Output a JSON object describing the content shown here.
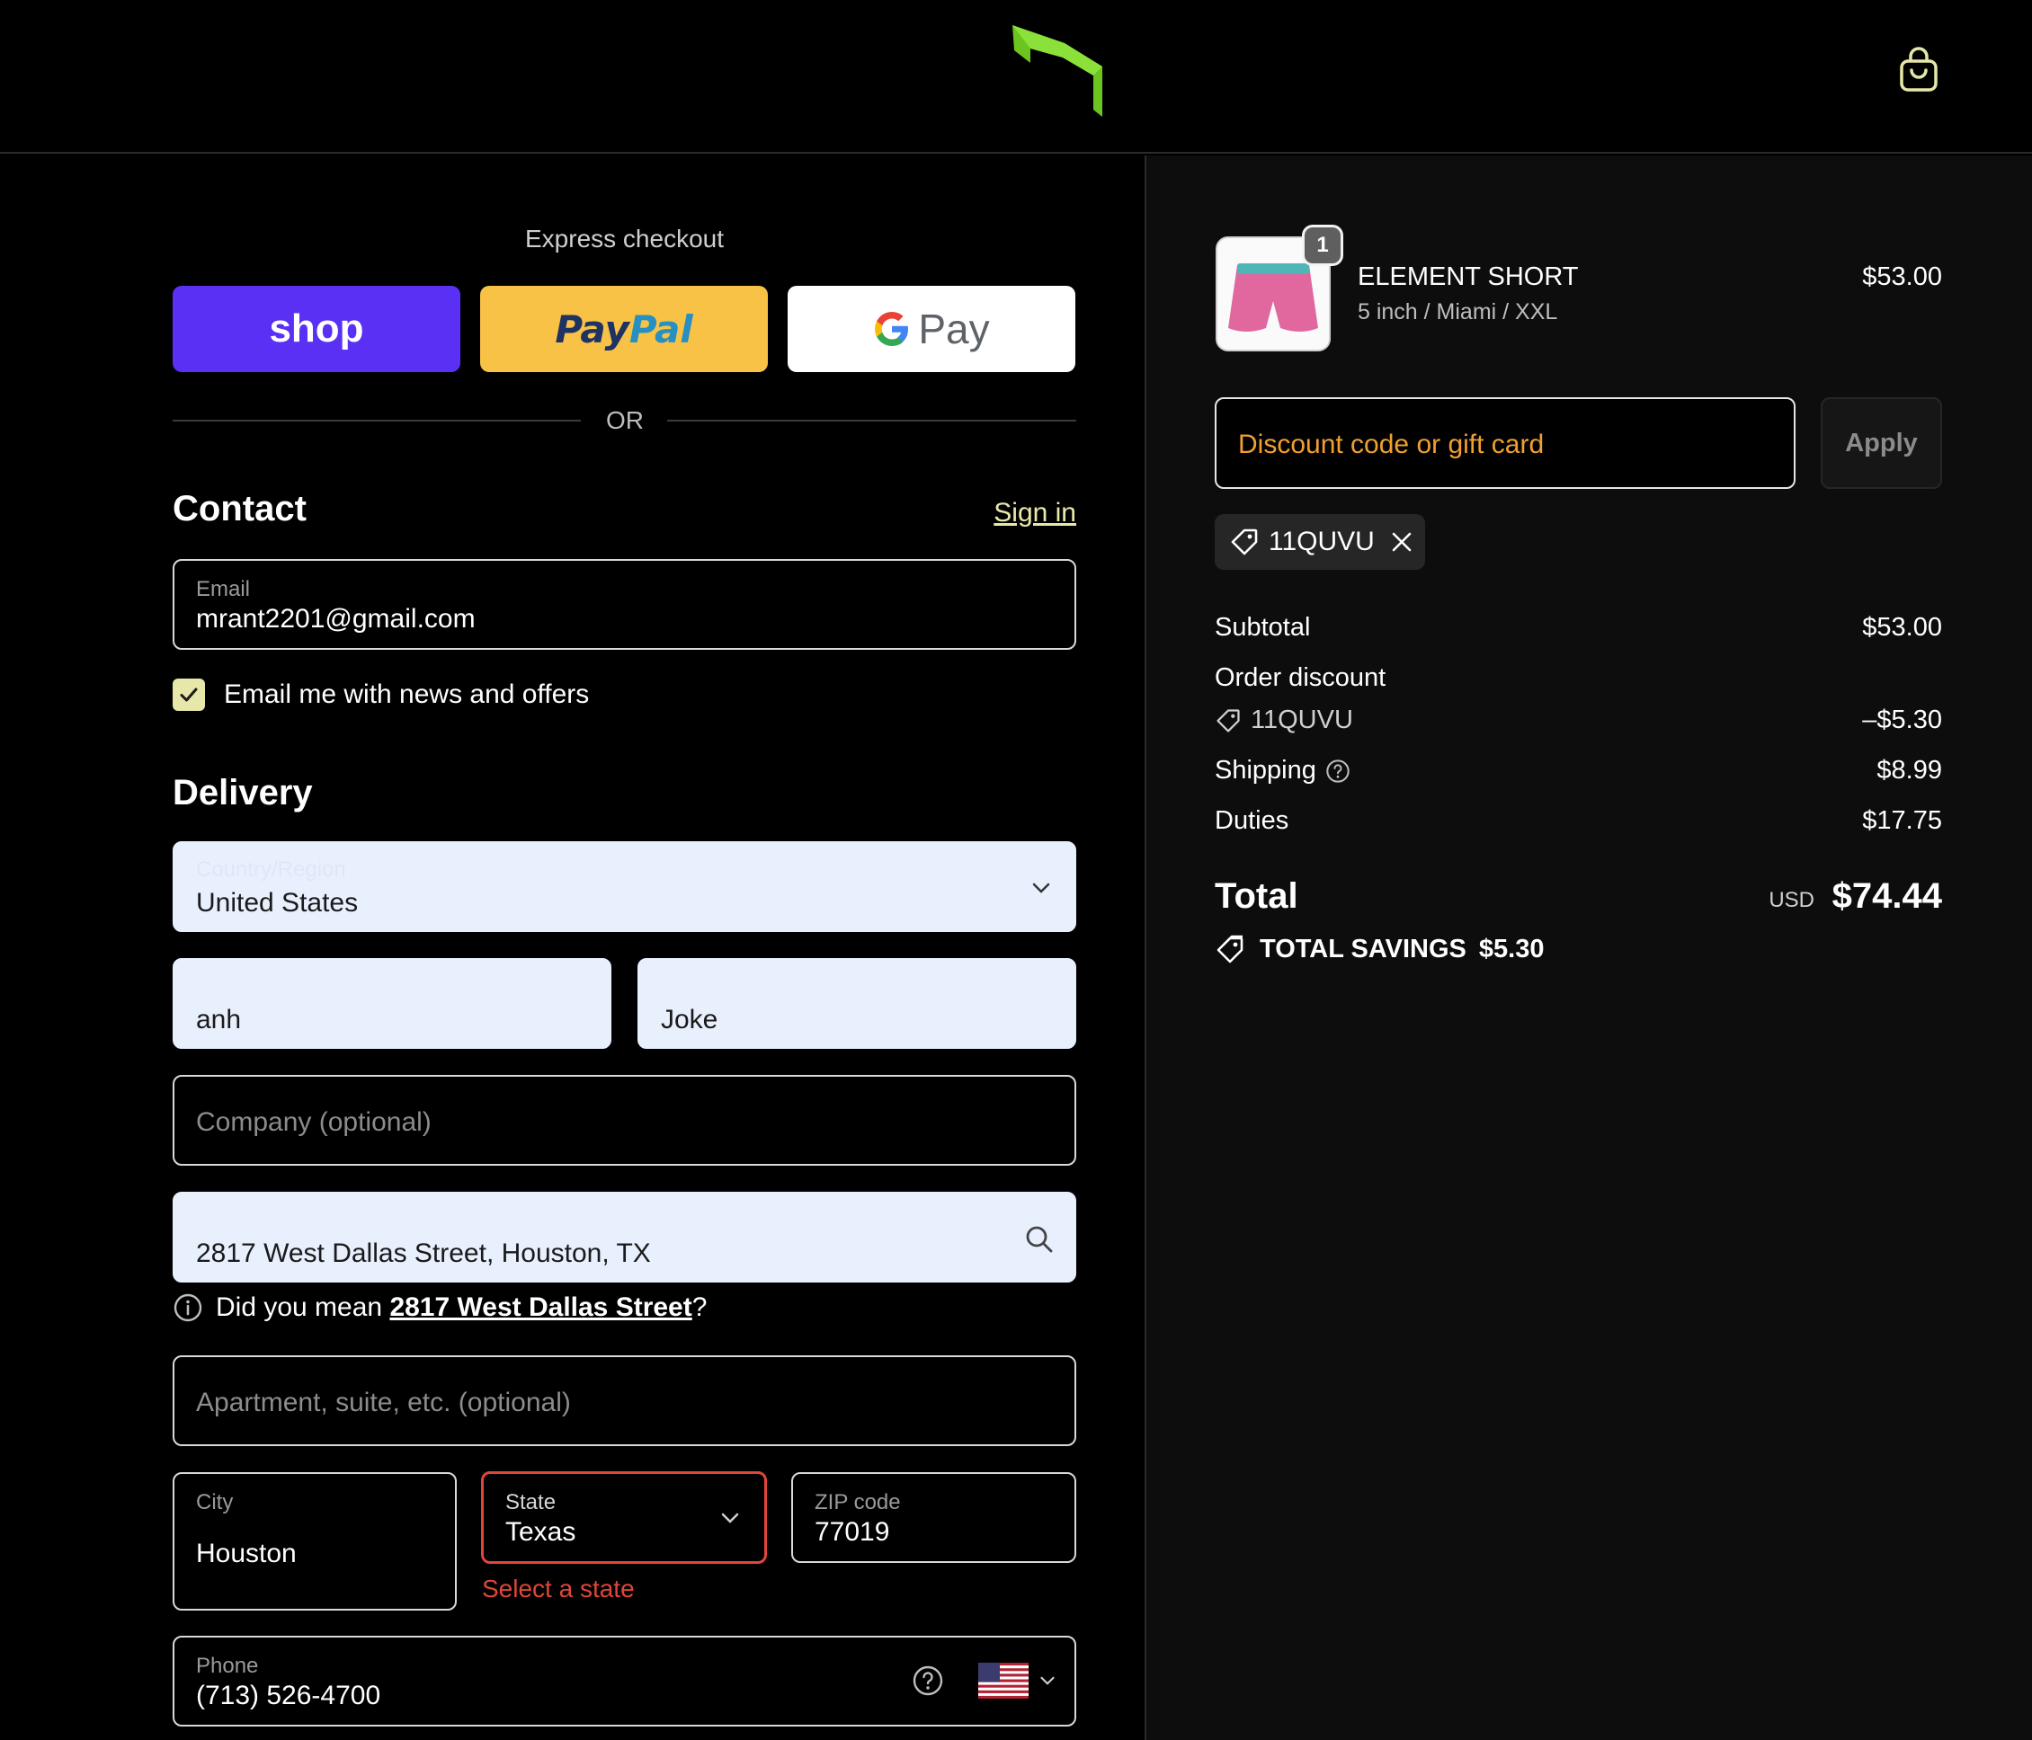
{
  "express": {
    "title": "Express checkout",
    "shop_label": "shop",
    "paypal_part1": "Pay",
    "paypal_part2": "Pal",
    "gpay_label": "Pay",
    "or_label": "OR"
  },
  "contact": {
    "title": "Contact",
    "signin_label": "Sign in",
    "email_label": "Email",
    "email_value": "mrant2201@gmail.com",
    "newsletter_label": "Email me with news and offers",
    "newsletter_checked": true
  },
  "delivery": {
    "title": "Delivery",
    "country_label": "Country/Region",
    "country_value": "United States",
    "first_name": "anh",
    "last_name": "Joke",
    "company_placeholder": "Company (optional)",
    "address_value": "2817 West Dallas Street, Houston, TX",
    "suggest_prefix": "Did you mean ",
    "suggest_link": "2817 West Dallas Street",
    "suggest_suffix": "?",
    "apartment_placeholder": "Apartment, suite, etc. (optional)",
    "city_label": "City",
    "city_value": "Houston",
    "state_label": "State",
    "state_value": "Texas",
    "state_error": "Select a state",
    "zip_label": "ZIP code",
    "zip_value": "77019",
    "phone_label": "Phone",
    "phone_value": "(713) 526-4700"
  },
  "summary": {
    "product": {
      "name": "ELEMENT SHORT",
      "variant": "5 inch / Miami / XXL",
      "price": "$53.00",
      "quantity": "1"
    },
    "discount_placeholder": "Discount code or gift card",
    "apply_label": "Apply",
    "applied_code": "11QUVU",
    "subtotal_label": "Subtotal",
    "subtotal_value": "$53.00",
    "order_discount_label": "Order discount",
    "discount_code": "11QUVU",
    "discount_value": "–$5.30",
    "shipping_label": "Shipping",
    "shipping_value": "$8.99",
    "duties_label": "Duties",
    "duties_value": "$17.75",
    "total_label": "Total",
    "currency": "USD",
    "total_value": "$74.44",
    "savings_label": "TOTAL SAVINGS",
    "savings_value": "$5.30"
  },
  "colors": {
    "accent": "#e6e7a8",
    "shop_purple": "#5a31f4",
    "paypal_yellow": "#f7c245",
    "error": "#e0453a",
    "logo_green": "#7ed321"
  }
}
